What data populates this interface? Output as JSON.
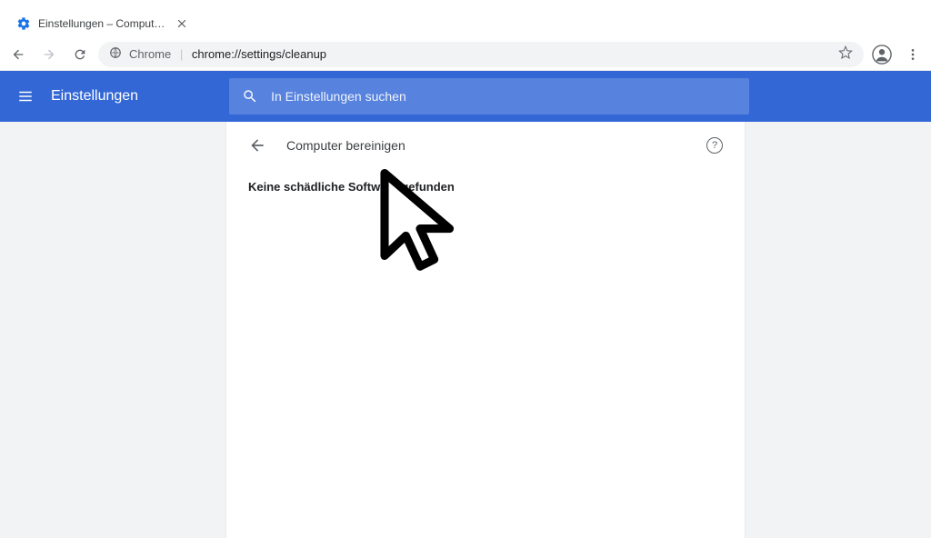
{
  "window": {
    "tab_title": "Einstellungen – Computer berein"
  },
  "toolbar": {
    "url_prefix": "Chrome",
    "url_scheme": "chrome://",
    "url_host": "settings",
    "url_path": "/cleanup"
  },
  "header": {
    "title": "Einstellungen",
    "search_placeholder": "In Einstellungen suchen"
  },
  "page": {
    "title": "Computer bereinigen",
    "result": "Keine schädliche Software gefunden"
  },
  "colors": {
    "accent": "#3367d6"
  }
}
